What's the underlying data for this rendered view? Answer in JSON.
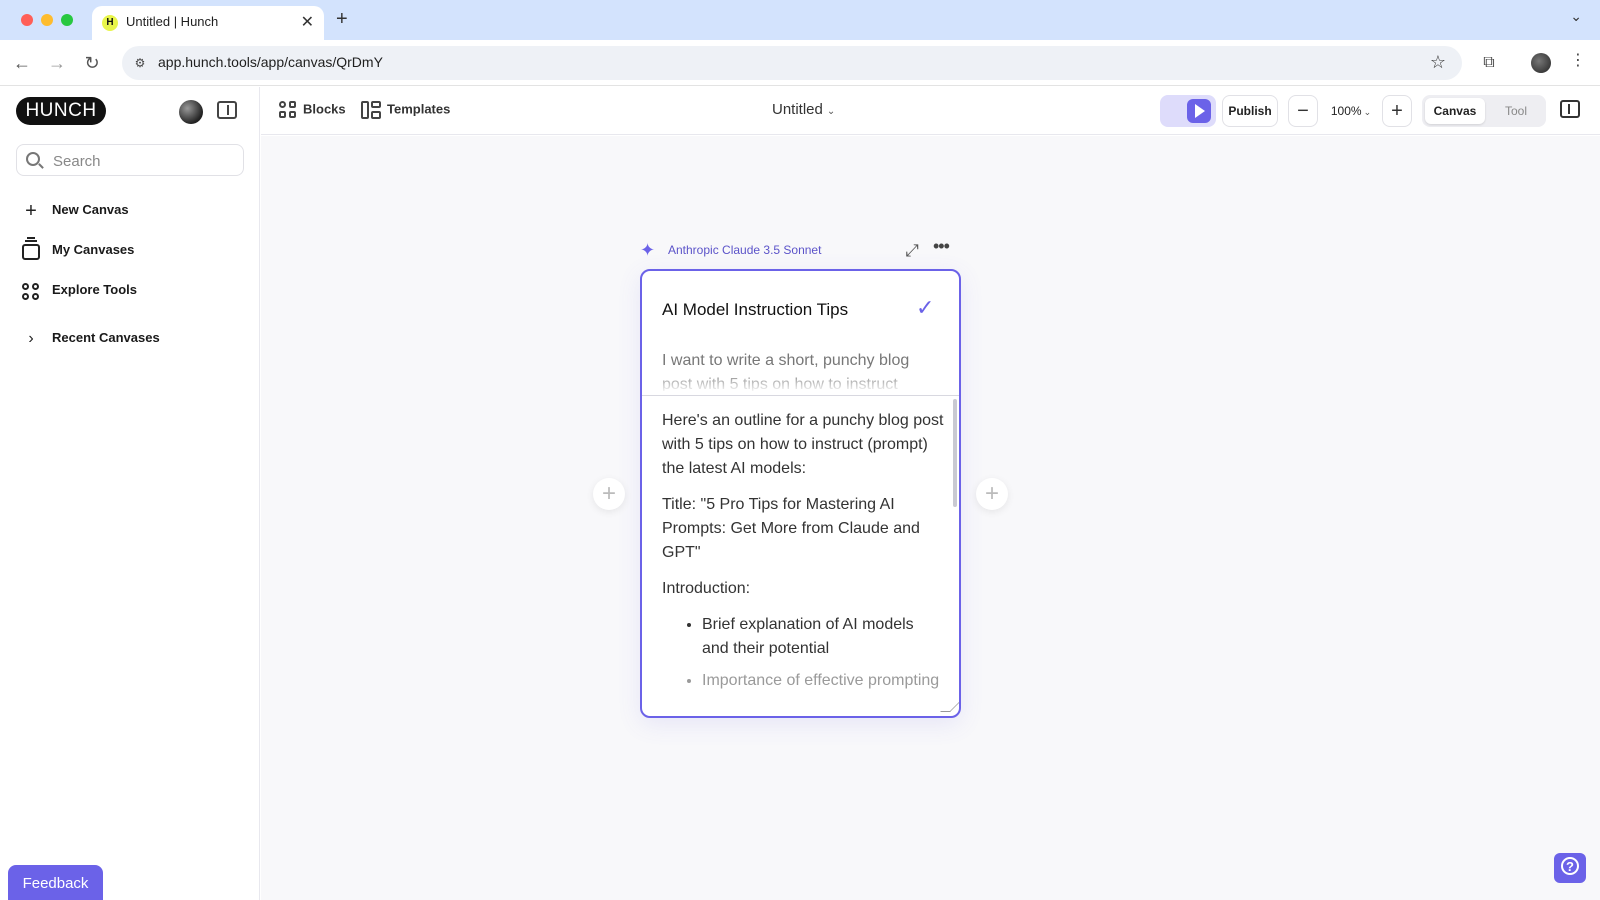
{
  "browser": {
    "tab_title": "Untitled | Hunch",
    "favicon": "H",
    "url": "app.hunch.tools/app/canvas/QrDmY"
  },
  "sidebar": {
    "logo": "HUNCH",
    "search_placeholder": "Search",
    "items": [
      {
        "label": "New Canvas",
        "icon": "plus-icon"
      },
      {
        "label": "My Canvases",
        "icon": "stack-icon"
      },
      {
        "label": "Explore Tools",
        "icon": "grid-icon"
      },
      {
        "label": "Recent Canvases",
        "icon": "chevron-right-icon"
      }
    ],
    "feedback_label": "Feedback"
  },
  "toolbar": {
    "blocks_label": "Blocks",
    "templates_label": "Templates",
    "canvas_title": "Untitled",
    "publish_label": "Publish",
    "zoom": "100%",
    "mode_canvas": "Canvas",
    "mode_tool": "Tool"
  },
  "block": {
    "model": "Anthropic Claude 3.5 Sonnet",
    "title": "AI Model Instruction Tips",
    "prompt": "I want to write a short, punchy blog post with 5 tips on how to instruct",
    "output": {
      "intro": "Here's an outline for a punchy blog post with 5 tips on how to instruct (prompt) the latest AI models:",
      "title_line": "Title: \"5 Pro Tips for Mastering AI Prompts: Get More from Claude and GPT\"",
      "introduction_heading": "Introduction:",
      "bullets": [
        "Brief explanation of AI models and their potential",
        "Importance of effective prompting"
      ]
    }
  },
  "colors": {
    "accent": "#6b62e8",
    "canvas_bg": "#f8f8fa",
    "chrome_tabbar": "#d3e3fd"
  }
}
